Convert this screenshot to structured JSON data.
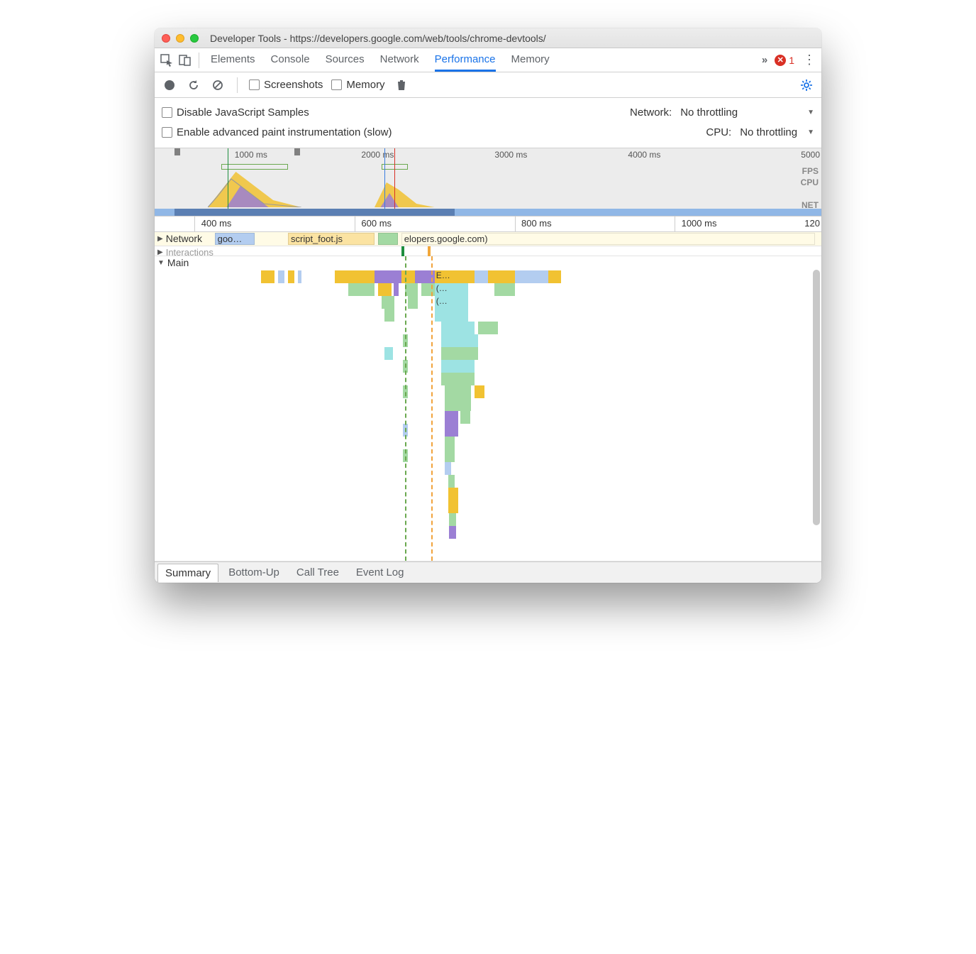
{
  "window": {
    "title": "Developer Tools - https://developers.google.com/web/tools/chrome-devtools/"
  },
  "tabbar": {
    "tabs": [
      "Elements",
      "Console",
      "Sources",
      "Network",
      "Performance",
      "Memory"
    ],
    "active": "Performance",
    "overflow": "»",
    "error_count": "1"
  },
  "toolbar": {
    "screenshots": "Screenshots",
    "memory": "Memory"
  },
  "options": {
    "disable_js": "Disable JavaScript Samples",
    "enable_paint": "Enable advanced paint instrumentation (slow)",
    "network_label": "Network:",
    "network_value": "No throttling",
    "cpu_label": "CPU:",
    "cpu_value": "No throttling"
  },
  "overview": {
    "ticks": [
      "1000 ms",
      "2000 ms",
      "3000 ms",
      "4000 ms",
      "5000"
    ],
    "labels": [
      "FPS",
      "CPU",
      "NET"
    ]
  },
  "ruler": {
    "ticks": [
      "400 ms",
      "600 ms",
      "800 ms",
      "1000 ms",
      "120"
    ]
  },
  "tracks": {
    "network_label": "Network",
    "network_items": [
      "goo…",
      "script_foot.js",
      "elopers.google.com)"
    ],
    "interactions_label": "Interactions",
    "main_label": "Main",
    "main_items": [
      "E…",
      "(…",
      "(…"
    ]
  },
  "bottom_tabs": {
    "tabs": [
      "Summary",
      "Bottom-Up",
      "Call Tree",
      "Event Log"
    ],
    "active": "Summary"
  }
}
